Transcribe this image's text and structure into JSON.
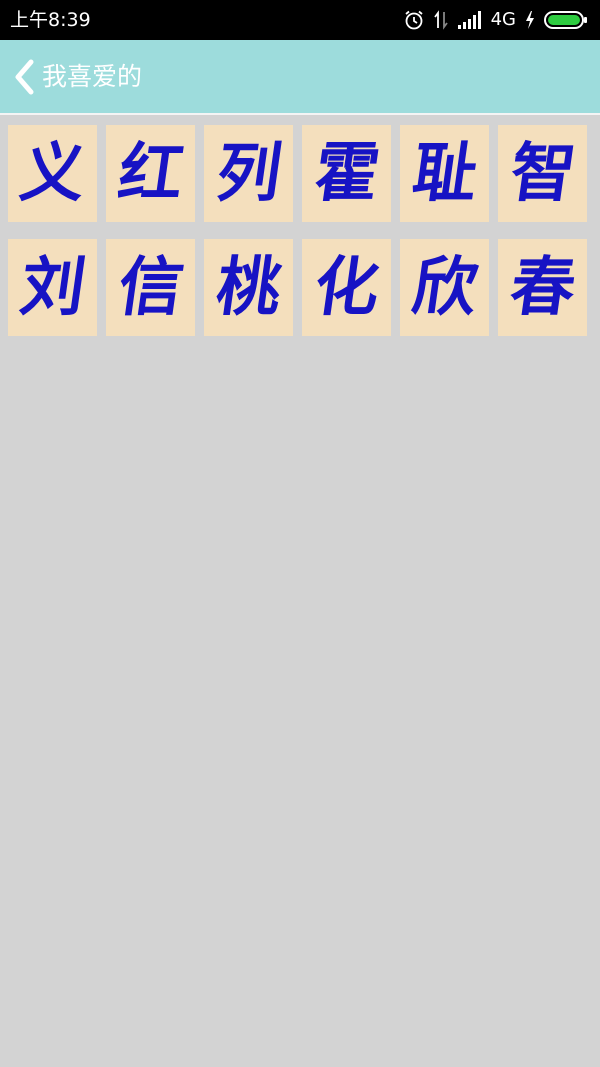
{
  "status_bar": {
    "time": "上午8:39",
    "network": "4G",
    "icons": [
      "alarm-icon",
      "data-transfer-icon",
      "signal-icon",
      "charging-icon",
      "battery-icon"
    ]
  },
  "header": {
    "back_icon": "chevron-left-icon",
    "title": "我喜爱的",
    "background": "#9ddcdc"
  },
  "favorites": {
    "tile_color": "#f4dfbd",
    "char_color": "#1713c4",
    "rows": [
      [
        "义",
        "红",
        "列",
        "霍",
        "耻",
        "智"
      ],
      [
        "刘",
        "信",
        "桃",
        "化",
        "欣",
        "春"
      ]
    ]
  }
}
